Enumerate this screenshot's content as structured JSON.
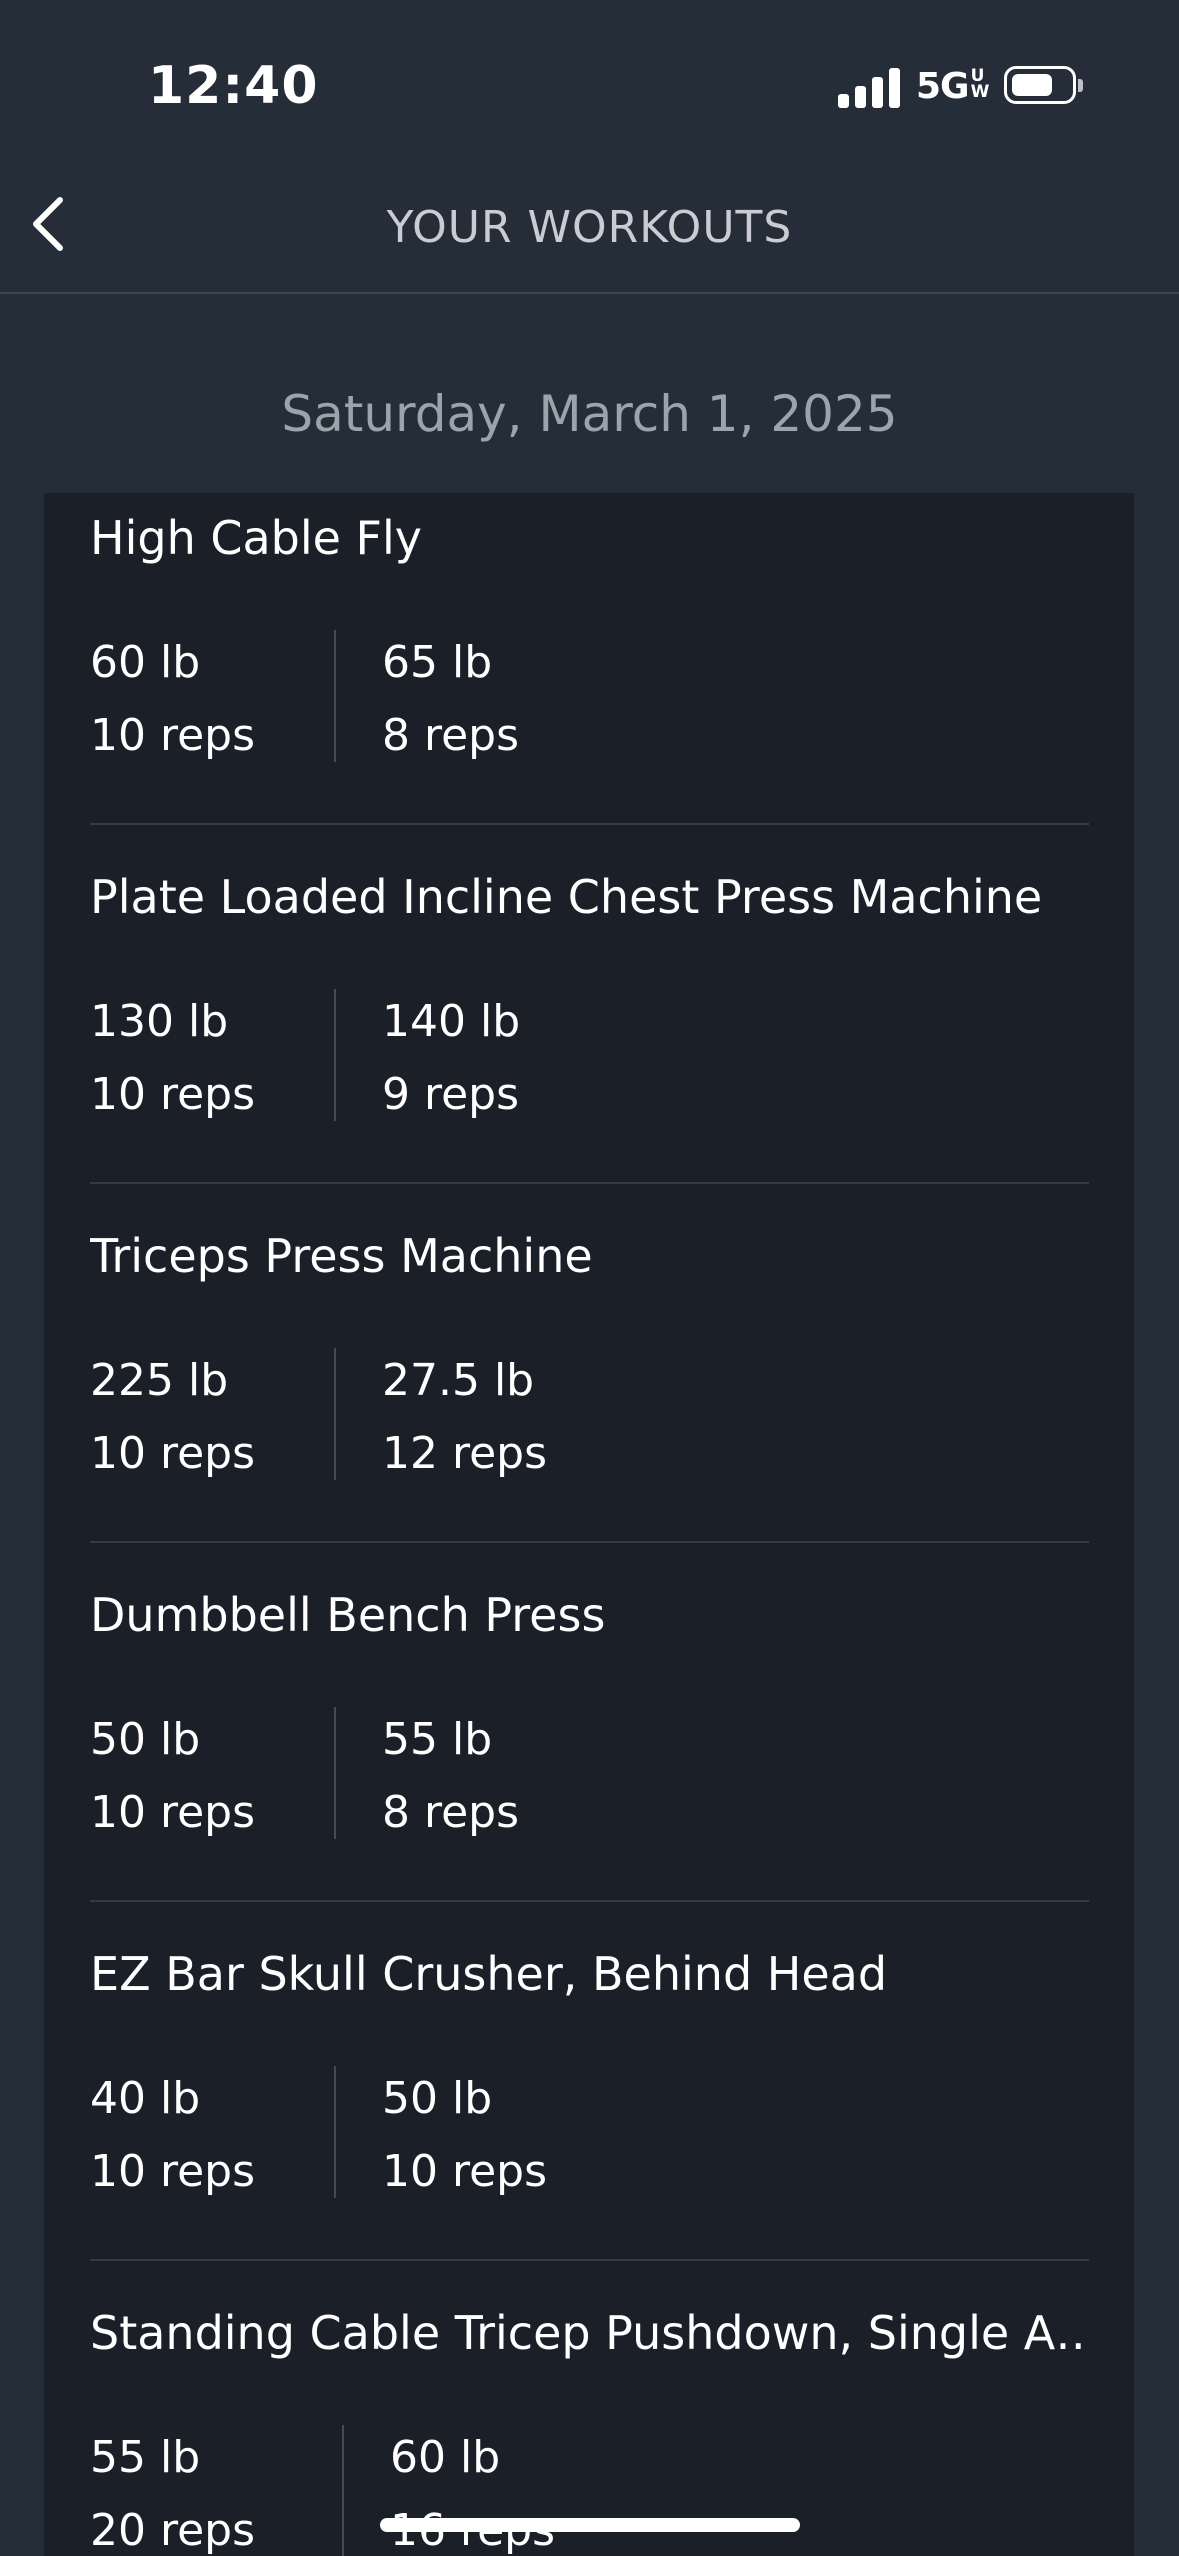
{
  "status_bar": {
    "time": "12:40",
    "network": "5G",
    "network_badge": "UW",
    "icons": [
      "signal-bars-icon",
      "battery-icon"
    ]
  },
  "nav": {
    "title": "YOUR WORKOUTS",
    "back_icon": "chevron-left-icon"
  },
  "date": "Saturday, March 1, 2025",
  "exercises": [
    {
      "name": "High Cable Fly",
      "sets": [
        {
          "weight": "60 lb",
          "reps": "10 reps"
        },
        {
          "weight": "65 lb",
          "reps": "8 reps"
        }
      ]
    },
    {
      "name": "Plate Loaded Incline Chest Press Machine",
      "sets": [
        {
          "weight": "130 lb",
          "reps": "10 reps"
        },
        {
          "weight": "140 lb",
          "reps": "9 reps"
        }
      ]
    },
    {
      "name": "Triceps Press Machine",
      "sets": [
        {
          "weight": "225 lb",
          "reps": "10 reps"
        },
        {
          "weight": "27.5 lb",
          "reps": "12 reps"
        }
      ]
    },
    {
      "name": "Dumbbell Bench Press",
      "sets": [
        {
          "weight": "50 lb",
          "reps": "10 reps"
        },
        {
          "weight": "55 lb",
          "reps": "8 reps"
        }
      ]
    },
    {
      "name": "EZ Bar Skull Crusher, Behind Head",
      "sets": [
        {
          "weight": "40 lb",
          "reps": "10 reps"
        },
        {
          "weight": "50 lb",
          "reps": "10 reps"
        }
      ]
    },
    {
      "name": "Standing Cable Tricep Pushdown, Single A…",
      "sets": [
        {
          "weight": "55 lb",
          "reps": "20 reps"
        },
        {
          "weight": "60 lb",
          "reps": "16 reps"
        }
      ]
    }
  ],
  "colors": {
    "background": "#252d39",
    "card": "#1a1f28",
    "text": "#ffffff",
    "muted_text": "#9da3ab",
    "divider": "#343b46"
  }
}
